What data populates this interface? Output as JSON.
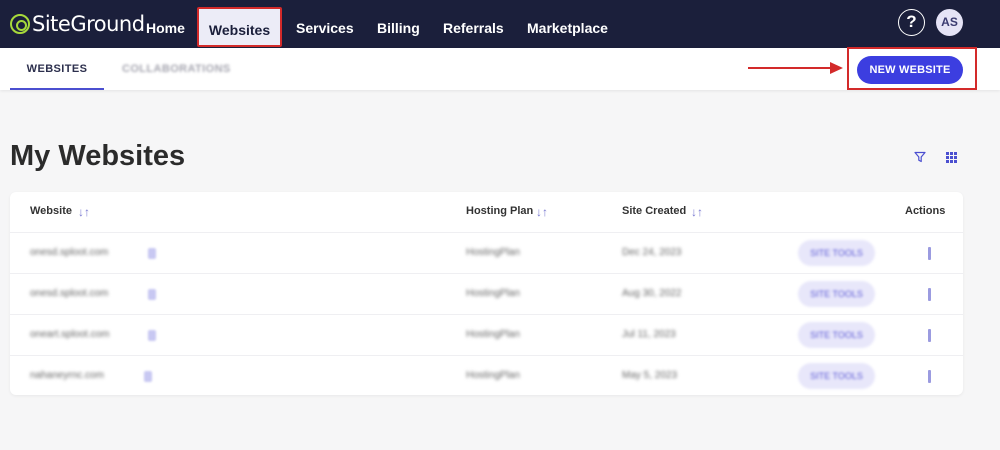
{
  "header": {
    "logo_text": "SiteGround",
    "nav": [
      "Home",
      "Websites",
      "Services",
      "Billing",
      "Referrals",
      "Marketplace"
    ],
    "help_label": "?",
    "avatar_initials": "AS"
  },
  "subnav": {
    "tabs": [
      "WEBSITES",
      "COLLABORATIONS"
    ],
    "new_website_label": "NEW WEBSITE"
  },
  "main": {
    "title": "My Websites",
    "table": {
      "headers": [
        "Website",
        "Hosting Plan",
        "Site Created",
        "Actions"
      ],
      "rows": [
        {
          "site": "onesd.sploot.com",
          "plan": "HostingPlan",
          "created": "Dec 24, 2023",
          "tools": "SITE TOOLS"
        },
        {
          "site": "onesd.sploot.com",
          "plan": "HostingPlan",
          "created": "Aug 30, 2022",
          "tools": "SITE TOOLS"
        },
        {
          "site": "oneart.sploot.com",
          "plan": "HostingPlan",
          "created": "Jul 11, 2023",
          "tools": "SITE TOOLS"
        },
        {
          "site": "nahaneyrnc.com",
          "plan": "HostingPlan",
          "created": "May 5, 2023",
          "tools": "SITE TOOLS"
        }
      ]
    }
  },
  "colors": {
    "nav_bg": "#1b1f3b",
    "accent": "#3c3ee0",
    "highlight": "#d32a2a",
    "logo": "#a7d93b"
  }
}
